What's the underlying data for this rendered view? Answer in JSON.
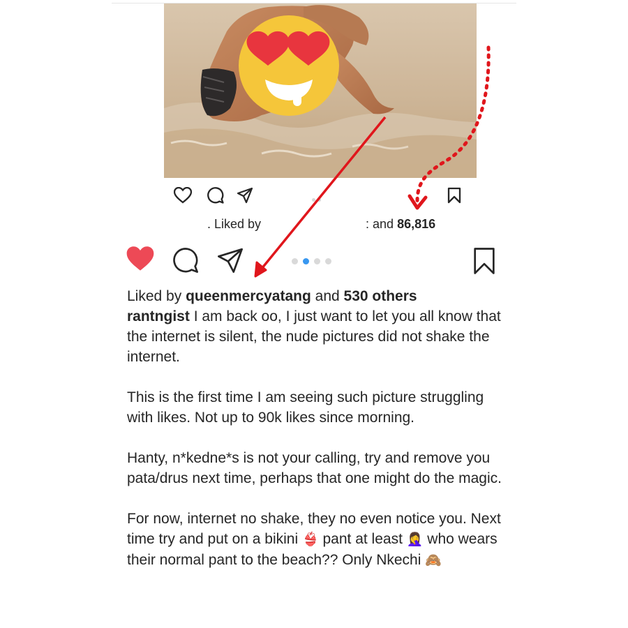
{
  "embedded": {
    "liked_by_prefix": ". Liked by",
    "and_label": ": and",
    "like_count": "86,816",
    "icons": [
      "heart-icon",
      "comment-icon",
      "share-icon",
      "bookmark-icon"
    ]
  },
  "post": {
    "liked_by_label": "Liked by",
    "liked_by_user": "queenmercyatang",
    "and_label": "and",
    "others_count": "530 others",
    "username": "rantngist",
    "caption_paragraphs": [
      "I am back oo, I just want to let you all know that the internet is silent, the nude pictures did not shake the internet.",
      "This is the first time I am seeing such picture struggling with likes. Not up to 90k likes since morning.",
      "Hanty, n*kedne*s is not your calling, try and remove you pata/drus next time, perhaps that one might do the magic."
    ],
    "last_paragraph": {
      "part1": "For now, internet no shake, they no even notice you. Next time try and put on a bikini",
      "emoji1": "👙",
      "part2": "pant at least",
      "emoji2": "🤦‍♀️",
      "part3": "who wears their normal pant to the beach?? Only Nkechi",
      "emoji3": "🙈"
    },
    "carousel": {
      "count": 4,
      "active": 1
    },
    "liked": true,
    "colors": {
      "like_red": "#ed4956",
      "carousel_active": "#3897f0",
      "annotation_red": "#e0161c",
      "emoji_yellow": "#f5c63a"
    }
  }
}
